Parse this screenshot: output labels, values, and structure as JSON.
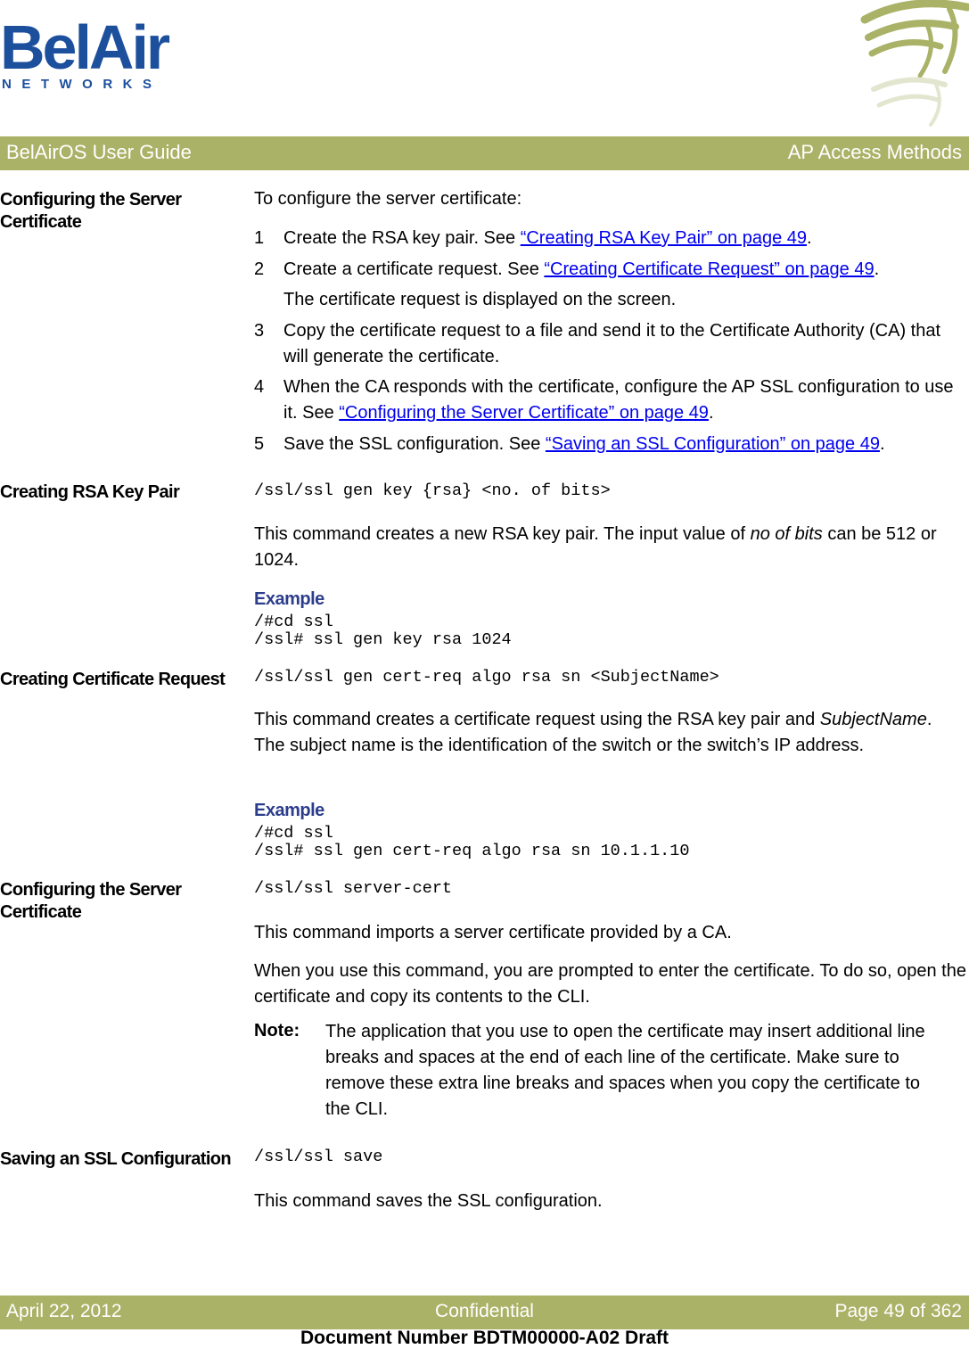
{
  "logo": {
    "brand": "BelAir",
    "sub": "NETWORKS"
  },
  "header": {
    "left": "BelAirOS User Guide",
    "right": "AP Access Methods"
  },
  "sections": {
    "config_cert": {
      "title": "Configuring the Server Certificate",
      "intro": "To configure the server certificate:",
      "steps": [
        {
          "num": "1",
          "text": "Create the RSA key pair. See ",
          "link": "“Creating RSA Key Pair” on page 49",
          "after": "."
        },
        {
          "num": "2",
          "text": "Create a certificate request. See ",
          "link": "“Creating Certificate Request” on page 49",
          "after": "."
        },
        {
          "num": "",
          "text": "The certificate request is displayed on the screen."
        },
        {
          "num": "3",
          "text": "Copy the certificate request to a file and send it to the Certificate Authority (CA) that will generate the certificate."
        },
        {
          "num": "4",
          "text": "When the CA responds with the certificate, configure the AP SSL configuration to use it. See ",
          "link": "“Configuring the Server Certificate” on page 49",
          "after": "."
        },
        {
          "num": "5",
          "text": "Save the SSL configuration. See ",
          "link": "“Saving an SSL Configuration” on page 49",
          "after": "."
        }
      ]
    },
    "rsa": {
      "title": "Creating RSA Key Pair",
      "command": "/ssl/ssl gen key {rsa} <no. of bits>",
      "desc_pre": "This command creates a new RSA key pair. The input value of ",
      "desc_em": "no of bits",
      "desc_post": " can be 512 or 1024.",
      "example_label": "Example",
      "example": "/#cd ssl\n/ssl# ssl gen key rsa 1024"
    },
    "cert_req": {
      "title": "Creating Certificate Request",
      "command": "/ssl/ssl gen cert-req algo rsa sn <SubjectName>",
      "desc_pre": "This command creates a certificate request using the RSA key pair and ",
      "desc_em": "SubjectName",
      "desc_post": ". The subject name is the identification of the switch or the switch’s IP address.",
      "example_label": "Example",
      "example": "/#cd ssl\n/ssl# ssl gen cert-req algo rsa sn 10.1.1.10"
    },
    "server_cert": {
      "title": "Configuring the Server Certificate",
      "command": "/ssl/ssl server-cert",
      "desc1": "This command imports a server certificate provided by a CA.",
      "desc2": "When you use this command, you are prompted to enter the certificate. To do so, open the certificate and copy its contents to the CLI.",
      "note_label": "Note:",
      "note": "The application that you use to open the certificate may insert additional line breaks and spaces at the end of each line of the certificate. Make sure to remove these extra line breaks and spaces when you copy the certificate to the CLI."
    },
    "save": {
      "title": "Saving an SSL Configuration",
      "command": "/ssl/ssl save",
      "desc": "This command saves the SSL configuration."
    }
  },
  "footer": {
    "date": "April 22, 2012",
    "center": "Confidential",
    "page": "Page 49 of 362",
    "docnum": "Document Number BDTM00000-A02 Draft"
  }
}
